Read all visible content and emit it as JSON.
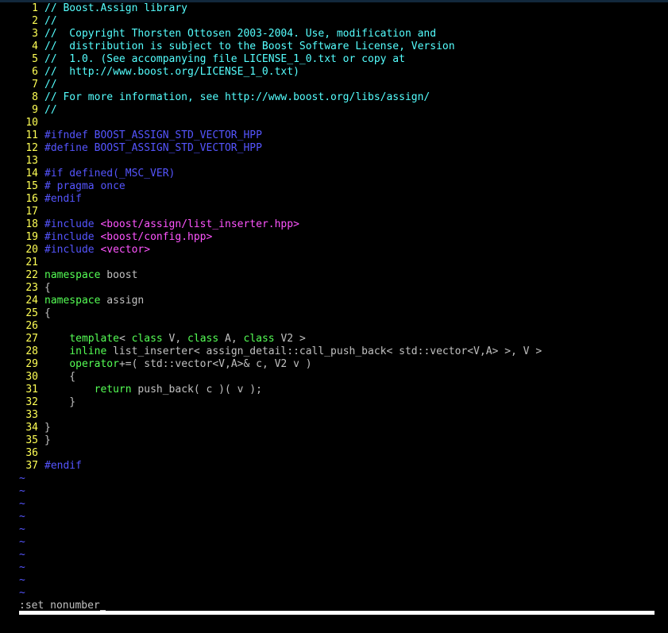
{
  "colors": {
    "comment": "#55ffff",
    "preproc": "#5555ff",
    "string": "#ff55ff",
    "keyword": "#55ff55",
    "text": "#c0c0c0",
    "linenr": "#ffff55",
    "tilde": "#5555ff"
  },
  "lines": [
    {
      "n": "1",
      "tokens": [
        {
          "t": "// Boost.Assign library",
          "c": "comment"
        }
      ]
    },
    {
      "n": "2",
      "tokens": [
        {
          "t": "//",
          "c": "comment"
        }
      ]
    },
    {
      "n": "3",
      "tokens": [
        {
          "t": "//  Copyright Thorsten Ottosen 2003-2004. Use, modification and",
          "c": "comment"
        }
      ]
    },
    {
      "n": "4",
      "tokens": [
        {
          "t": "//  distribution is subject to the Boost Software License, Version",
          "c": "comment"
        }
      ]
    },
    {
      "n": "5",
      "tokens": [
        {
          "t": "//  1.0. (See accompanying file LICENSE_1_0.txt or copy at",
          "c": "comment"
        }
      ]
    },
    {
      "n": "6",
      "tokens": [
        {
          "t": "//  http://www.boost.org/LICENSE_1_0.txt)",
          "c": "comment"
        }
      ]
    },
    {
      "n": "7",
      "tokens": [
        {
          "t": "//",
          "c": "comment"
        }
      ]
    },
    {
      "n": "8",
      "tokens": [
        {
          "t": "// For more information, see http://www.boost.org/libs/assign/",
          "c": "comment"
        }
      ]
    },
    {
      "n": "9",
      "tokens": [
        {
          "t": "//",
          "c": "comment"
        }
      ]
    },
    {
      "n": "10",
      "tokens": []
    },
    {
      "n": "11",
      "tokens": [
        {
          "t": "#ifndef BOOST_ASSIGN_STD_VECTOR_HPP",
          "c": "preproc"
        }
      ]
    },
    {
      "n": "12",
      "tokens": [
        {
          "t": "#define BOOST_ASSIGN_STD_VECTOR_HPP",
          "c": "preproc"
        }
      ]
    },
    {
      "n": "13",
      "tokens": []
    },
    {
      "n": "14",
      "tokens": [
        {
          "t": "#if defined(_MSC_VER)",
          "c": "preproc"
        }
      ]
    },
    {
      "n": "15",
      "tokens": [
        {
          "t": "# pragma once",
          "c": "preproc"
        }
      ]
    },
    {
      "n": "16",
      "tokens": [
        {
          "t": "#endif",
          "c": "preproc"
        }
      ]
    },
    {
      "n": "17",
      "tokens": []
    },
    {
      "n": "18",
      "tokens": [
        {
          "t": "#include ",
          "c": "preproc"
        },
        {
          "t": "<boost/assign/list_inserter.hpp>",
          "c": "string"
        }
      ]
    },
    {
      "n": "19",
      "tokens": [
        {
          "t": "#include ",
          "c": "preproc"
        },
        {
          "t": "<boost/config.hpp>",
          "c": "string"
        }
      ]
    },
    {
      "n": "20",
      "tokens": [
        {
          "t": "#include ",
          "c": "preproc"
        },
        {
          "t": "<vector>",
          "c": "string"
        }
      ]
    },
    {
      "n": "21",
      "tokens": []
    },
    {
      "n": "22",
      "tokens": [
        {
          "t": "namespace",
          "c": "keyword"
        },
        {
          "t": " boost",
          "c": "text"
        }
      ]
    },
    {
      "n": "23",
      "tokens": [
        {
          "t": "{",
          "c": "text"
        }
      ]
    },
    {
      "n": "24",
      "tokens": [
        {
          "t": "namespace",
          "c": "keyword"
        },
        {
          "t": " assign",
          "c": "text"
        }
      ]
    },
    {
      "n": "25",
      "tokens": [
        {
          "t": "{",
          "c": "text"
        }
      ]
    },
    {
      "n": "26",
      "tokens": []
    },
    {
      "n": "27",
      "tokens": [
        {
          "t": "    ",
          "c": "text"
        },
        {
          "t": "template",
          "c": "keyword"
        },
        {
          "t": "< ",
          "c": "text"
        },
        {
          "t": "class",
          "c": "keyword"
        },
        {
          "t": " V, ",
          "c": "text"
        },
        {
          "t": "class",
          "c": "keyword"
        },
        {
          "t": " A, ",
          "c": "text"
        },
        {
          "t": "class",
          "c": "keyword"
        },
        {
          "t": " V2 >",
          "c": "text"
        }
      ]
    },
    {
      "n": "28",
      "tokens": [
        {
          "t": "    ",
          "c": "text"
        },
        {
          "t": "inline",
          "c": "keyword"
        },
        {
          "t": " list_inserter< assign_detail::call_push_back< std::vector<V,A> >, V >",
          "c": "text"
        }
      ]
    },
    {
      "n": "29",
      "tokens": [
        {
          "t": "    ",
          "c": "text"
        },
        {
          "t": "operator",
          "c": "keyword"
        },
        {
          "t": "+=( std::vector<V,A>& c, V2 v )",
          "c": "text"
        }
      ]
    },
    {
      "n": "30",
      "tokens": [
        {
          "t": "    {",
          "c": "text"
        }
      ]
    },
    {
      "n": "31",
      "tokens": [
        {
          "t": "        ",
          "c": "text"
        },
        {
          "t": "return",
          "c": "keyword"
        },
        {
          "t": " push_back( c )( v );",
          "c": "text"
        }
      ]
    },
    {
      "n": "32",
      "tokens": [
        {
          "t": "    }",
          "c": "text"
        }
      ]
    },
    {
      "n": "33",
      "tokens": []
    },
    {
      "n": "34",
      "tokens": [
        {
          "t": "}",
          "c": "text"
        }
      ]
    },
    {
      "n": "35",
      "tokens": [
        {
          "t": "}",
          "c": "text"
        }
      ]
    },
    {
      "n": "36",
      "tokens": []
    },
    {
      "n": "37",
      "tokens": [
        {
          "t": "#endif",
          "c": "preproc"
        }
      ]
    }
  ],
  "tildes": [
    "~",
    "~",
    "~",
    "~",
    "~",
    "~",
    "~",
    "~",
    "~",
    "~"
  ],
  "command_line": ":set nonumber"
}
